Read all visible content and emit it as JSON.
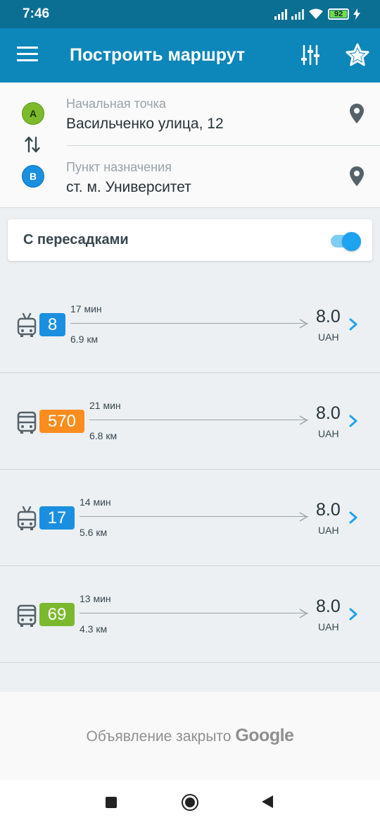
{
  "status": {
    "time": "7:46",
    "battery": "92"
  },
  "appbar": {
    "title": "Построить маршрут"
  },
  "points": {
    "start_label": "Начальная точка",
    "start_badge": "A",
    "start_value": "Васильченко улица, 12",
    "dest_label": "Пункт назначения",
    "dest_badge": "B",
    "dest_value": "ст. м. Университет"
  },
  "transfer": {
    "label": "С пересадками",
    "enabled": true
  },
  "routes": [
    {
      "vehicle": "trolleybus",
      "number": "8",
      "color": "#1a8fe0",
      "duration": "17 мин",
      "distance": "6.9 км",
      "price": "8.0",
      "currency": "UAH"
    },
    {
      "vehicle": "bus",
      "number": "570",
      "color": "#fb8c1e",
      "duration": "21 мин",
      "distance": "6.8 км",
      "price": "8.0",
      "currency": "UAH"
    },
    {
      "vehicle": "trolleybus",
      "number": "17",
      "color": "#1a8fe0",
      "duration": "14 мин",
      "distance": "5.6 км",
      "price": "8.0",
      "currency": "UAH"
    },
    {
      "vehicle": "bus",
      "number": "69",
      "color": "#7cb82f",
      "duration": "13 мин",
      "distance": "4.3 км",
      "price": "8.0",
      "currency": "UAH"
    }
  ],
  "ad": {
    "text": "Объявление закрыто",
    "brand": "Google"
  },
  "colors": {
    "primary": "#0d86b9",
    "statusbar": "#0b6f93",
    "accent": "#1ea3f0"
  }
}
